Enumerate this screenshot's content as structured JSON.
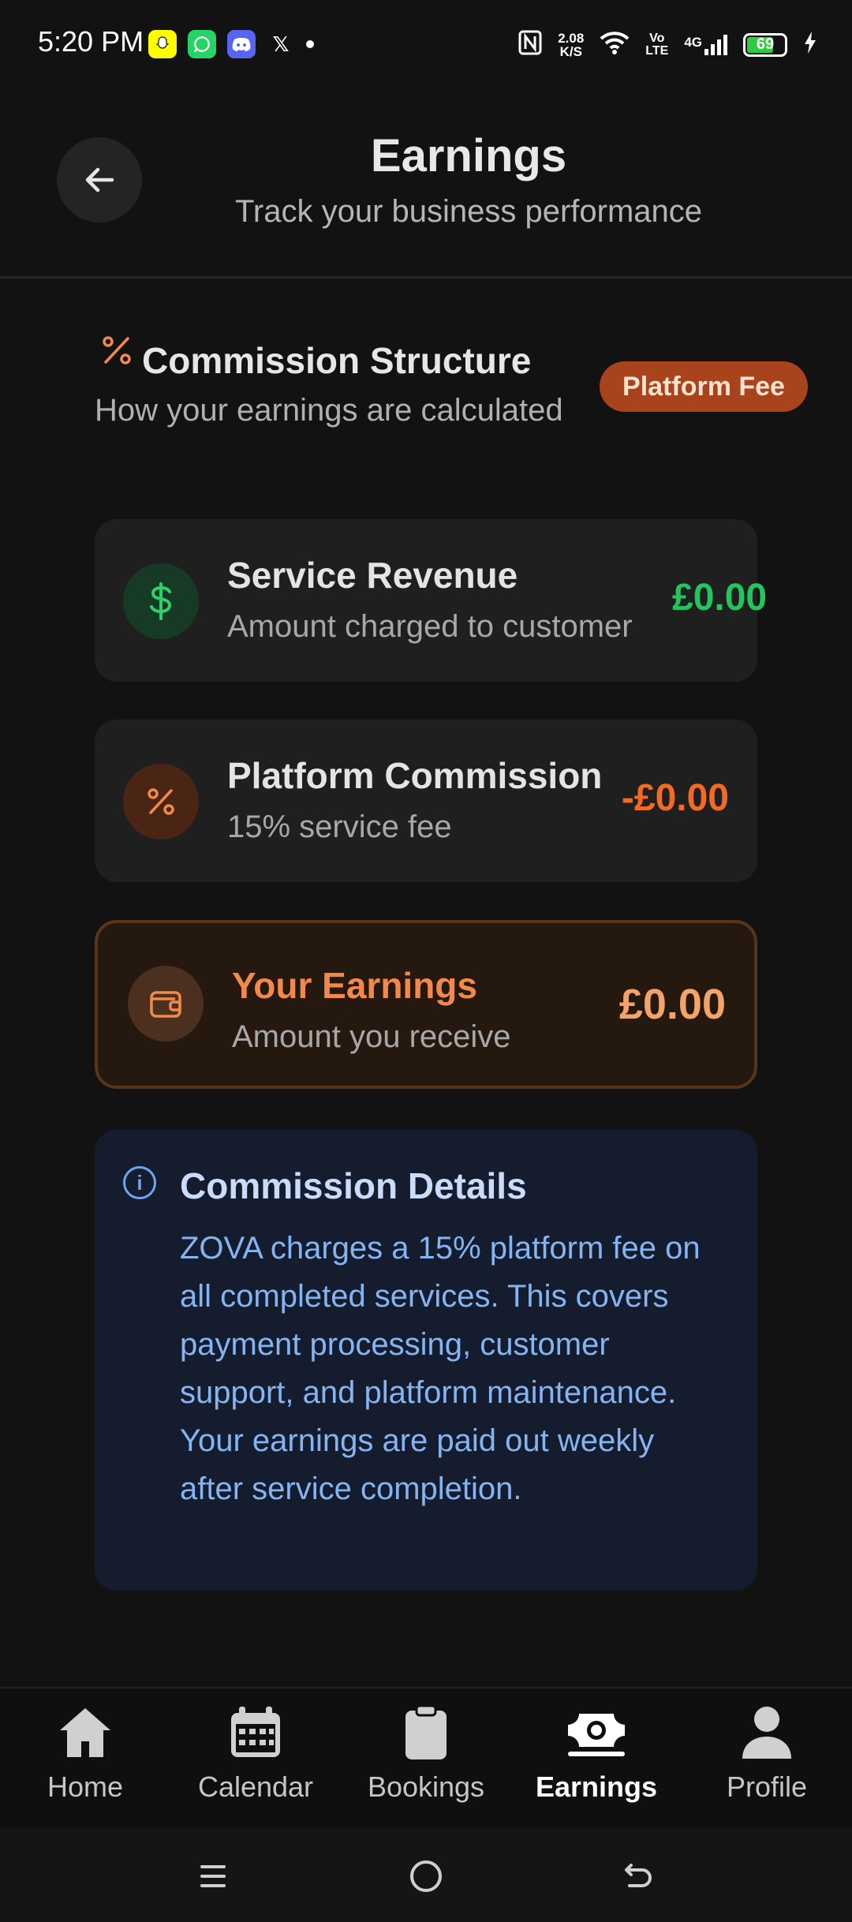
{
  "status_bar": {
    "time": "5:20 PM",
    "net_speed_top": "2.08",
    "net_speed_bottom": "K/S",
    "volte_top": "Vo",
    "volte_bottom": "LTE",
    "network": "4G",
    "battery": "69"
  },
  "header": {
    "title": "Earnings",
    "subtitle": "Track your business performance"
  },
  "commission": {
    "title": "Commission Structure",
    "subtitle": "How your earnings are calculated",
    "badge": "Platform Fee",
    "items": [
      {
        "title": "Service Revenue",
        "subtitle": "Amount charged to customer",
        "value": "£0.00",
        "icon": "dollar-icon"
      },
      {
        "title": "Platform Commission",
        "subtitle": "15% service fee",
        "value": "-£0.00",
        "icon": "percent-icon"
      },
      {
        "title": "Your Earnings",
        "subtitle": "Amount you receive",
        "value": "£0.00",
        "icon": "wallet-icon"
      }
    ]
  },
  "details": {
    "title": "Commission Details",
    "body": "ZOVA charges a 15% platform fee on all completed services. This covers payment processing, customer support, and platform maintenance. Your earnings are paid out weekly after service completion."
  },
  "nav": {
    "items": [
      {
        "label": "Home",
        "icon": "home-icon"
      },
      {
        "label": "Calendar",
        "icon": "calendar-icon"
      },
      {
        "label": "Bookings",
        "icon": "clipboard-icon"
      },
      {
        "label": "Earnings",
        "icon": "money-icon",
        "active": true
      },
      {
        "label": "Profile",
        "icon": "user-icon"
      }
    ]
  },
  "colors": {
    "accent": "#f2894a",
    "revenue": "#22c55e",
    "commission": "#f26a24",
    "info": "#85b4f2"
  }
}
